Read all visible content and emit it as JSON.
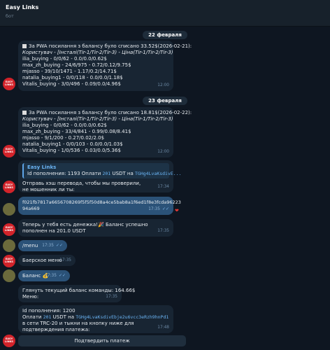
{
  "header": {
    "title": "Easy Links",
    "subtitle": "бот"
  },
  "avatars": {
    "bot_logo_lines": [
      "EASY",
      "LINKS"
    ]
  },
  "dates": [
    "22 февраля",
    "23 февраля"
  ],
  "reports": [
    {
      "header": "За PWA посилання з балансу було списано 33.52$(2026-02-21):",
      "columns": "Користувач - [Інсталі(Tir-1/Tir-2/Tir-3) - Ціна(Tir-1/Tir-2/Tir-3)",
      "rows": [
        "ilia_buying - 0/0/62 - 0.0/0.0/0.62$",
        "max_zh_buying - 24/6/975 - 0.72/0.12/9.75$",
        "mjasso - 39/10/1471 - 1.17/0.2/14.71$",
        "natalia_buying1 - 0/0/118 - 0.0/0.0/1.18$",
        "Vitalis_buying - 3/0/496 - 0.09/0.0/4.96$"
      ],
      "time": "12:00"
    },
    {
      "header": "За PWA посилання з балансу було списано 18.81$(2026-02-22):",
      "columns": "Користувач - [Інсталі(Tir-1/Tir-2/Tir-3) - Ціна(Tir-1/Tir-2/Tir-3)",
      "rows": [
        "ilia_buying - 0/0/62 - 0.0/0.0/0.62$",
        "max_zh_buying - 33/4/841 - 0.99/0.08/8.41$",
        "mjasso - 9/1/200 - 0.27/0.02/2.0$",
        "natalia_buying1 - 0/0/103 - 0.0/0.0/1.03$",
        "Vitalis_buying - 1/0/536 - 0.03/0.0/5.36$"
      ],
      "time": "12:00"
    }
  ],
  "reply_msg": {
    "quote_name": "Easy Links",
    "quote_text_prefix": "Id пополнения: 1193 Оплати ",
    "quote_amount": "201",
    "quote_text_mid": " USDT на ",
    "quote_wallet": "TGHg4LvaKsdivE...",
    "text": "Отправь хэш перевода, чтобы мы проверили, не мошенник ли ты:",
    "time": "17:34"
  },
  "hash_msg": {
    "text_line1": "f021fb7817a6656708269f5f5f50d8a4ce5bab8a1f6ed1f8e3fcda96223",
    "text_line2": "94a669",
    "time": "17:35",
    "reaction": "❤"
  },
  "success_msg": {
    "text": "Теперь у тебя есть денежка!🎉 Баланс успешно пополнен на 201.0 USDT",
    "time": "17:35"
  },
  "menu_cmd": {
    "text": "/menu",
    "time": "17:35"
  },
  "menu_msg": {
    "text": "Баерское меню",
    "time": "17:35"
  },
  "balance_cmd": {
    "text": "Баланс 💰",
    "time": "17:35"
  },
  "balance_msg": {
    "line1": "Глянуть текущий баланс команды: 164.66$",
    "line2": "Меню:",
    "time": "17:35"
  },
  "topup_msg": {
    "line1": "Id пополнения: 1200",
    "line2_prefix": "Оплати ",
    "amount": "201",
    "line2_mid": " USDT на ",
    "wallet": "TGHg4LvaKsdivEbje2u6vcc3eRzh9hnPd1",
    "line2_suffix": " в сети TRC-20 и тыкни на кнопку ниже для подтверждения платежа:",
    "time": "17:48"
  },
  "confirm_button": "Подтвердить платеж"
}
